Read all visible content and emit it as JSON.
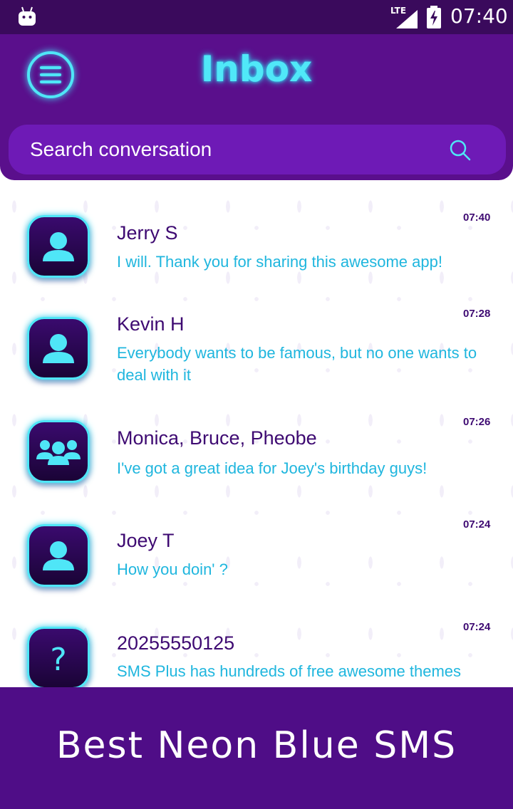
{
  "status_bar": {
    "network": "LTE",
    "time": "07:40",
    "icons": [
      "android-icon",
      "lte-signal-icon",
      "battery-charging-icon"
    ]
  },
  "header": {
    "title": "Inbox",
    "menu_icon": "hamburger-menu-icon",
    "search": {
      "placeholder": "Search conversation",
      "icon": "search-icon"
    }
  },
  "conversations": [
    {
      "name": "Jerry S",
      "preview": "I will. Thank you for sharing this awesome app!",
      "time": "07:40",
      "avatar": "person-icon"
    },
    {
      "name": "Kevin H",
      "preview": "Everybody wants to be famous, but no one wants to deal with it",
      "time": "07:28",
      "avatar": "person-icon"
    },
    {
      "name": "Monica, Bruce, Pheobe",
      "preview": "I've got a great idea for Joey's birthday guys!",
      "time": "07:26",
      "avatar": "group-icon"
    },
    {
      "name": "Joey T",
      "preview": "How you doin' ?",
      "time": "07:24",
      "avatar": "person-icon"
    },
    {
      "name": "20255550125",
      "preview": "SMS Plus has hundreds of free awesome themes",
      "time": "07:24",
      "avatar": "unknown-contact-icon"
    }
  ],
  "footer": {
    "text": "Best Neon Blue SMS"
  },
  "colors": {
    "header_bg": "#5a0f8c",
    "status_bar_bg": "#3a0a5c",
    "neon_accent": "#4fe6f7",
    "name_text": "#3e0a72",
    "preview_text": "#1fb6de",
    "footer_bg": "#4f0d87"
  }
}
